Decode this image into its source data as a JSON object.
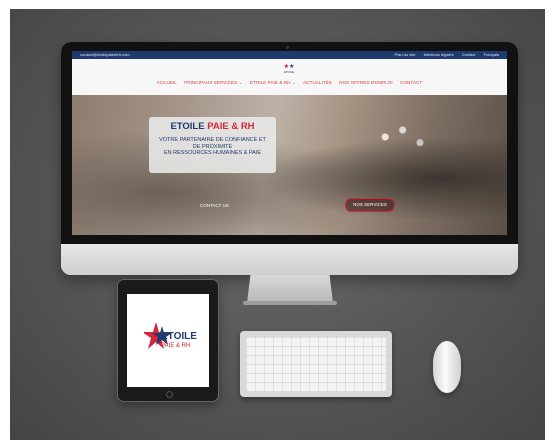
{
  "website": {
    "topbar": {
      "email": "contact@etoilepaieetrh.com",
      "links": [
        "Plan du site",
        "Mentions légales",
        "Contact",
        "Français"
      ]
    },
    "logo_mini": "ETOILE",
    "nav": [
      "ACCUEIL",
      "PRINCIPAUX SERVICES ⌄",
      "ETOILE PAIE & RH ⌄",
      "ACTUALITÉS",
      "NOS OFFRES D'EMPLOI",
      "CONTACT"
    ],
    "hero": {
      "title_main": "ETOILE",
      "title_accent": "PAIE & RH",
      "subtitle_lines": [
        "VOTRE PARTENAIRE DE CONFIANCE ET",
        "DE PROXIMITÉ",
        "EN RESSOURCES HUMAINES & PAIE"
      ],
      "contact_button": "CONTACT US",
      "more_button": "NOS SERVICES"
    }
  },
  "ipad": {
    "logo_text": "ETOILE",
    "logo_subtext": "PAIE & RH"
  },
  "colors": {
    "brand_blue": "#1f3a6e",
    "brand_red": "#d2283c",
    "background": "#555555"
  },
  "icons": {
    "apple_logo": "apple-logo-icon"
  }
}
